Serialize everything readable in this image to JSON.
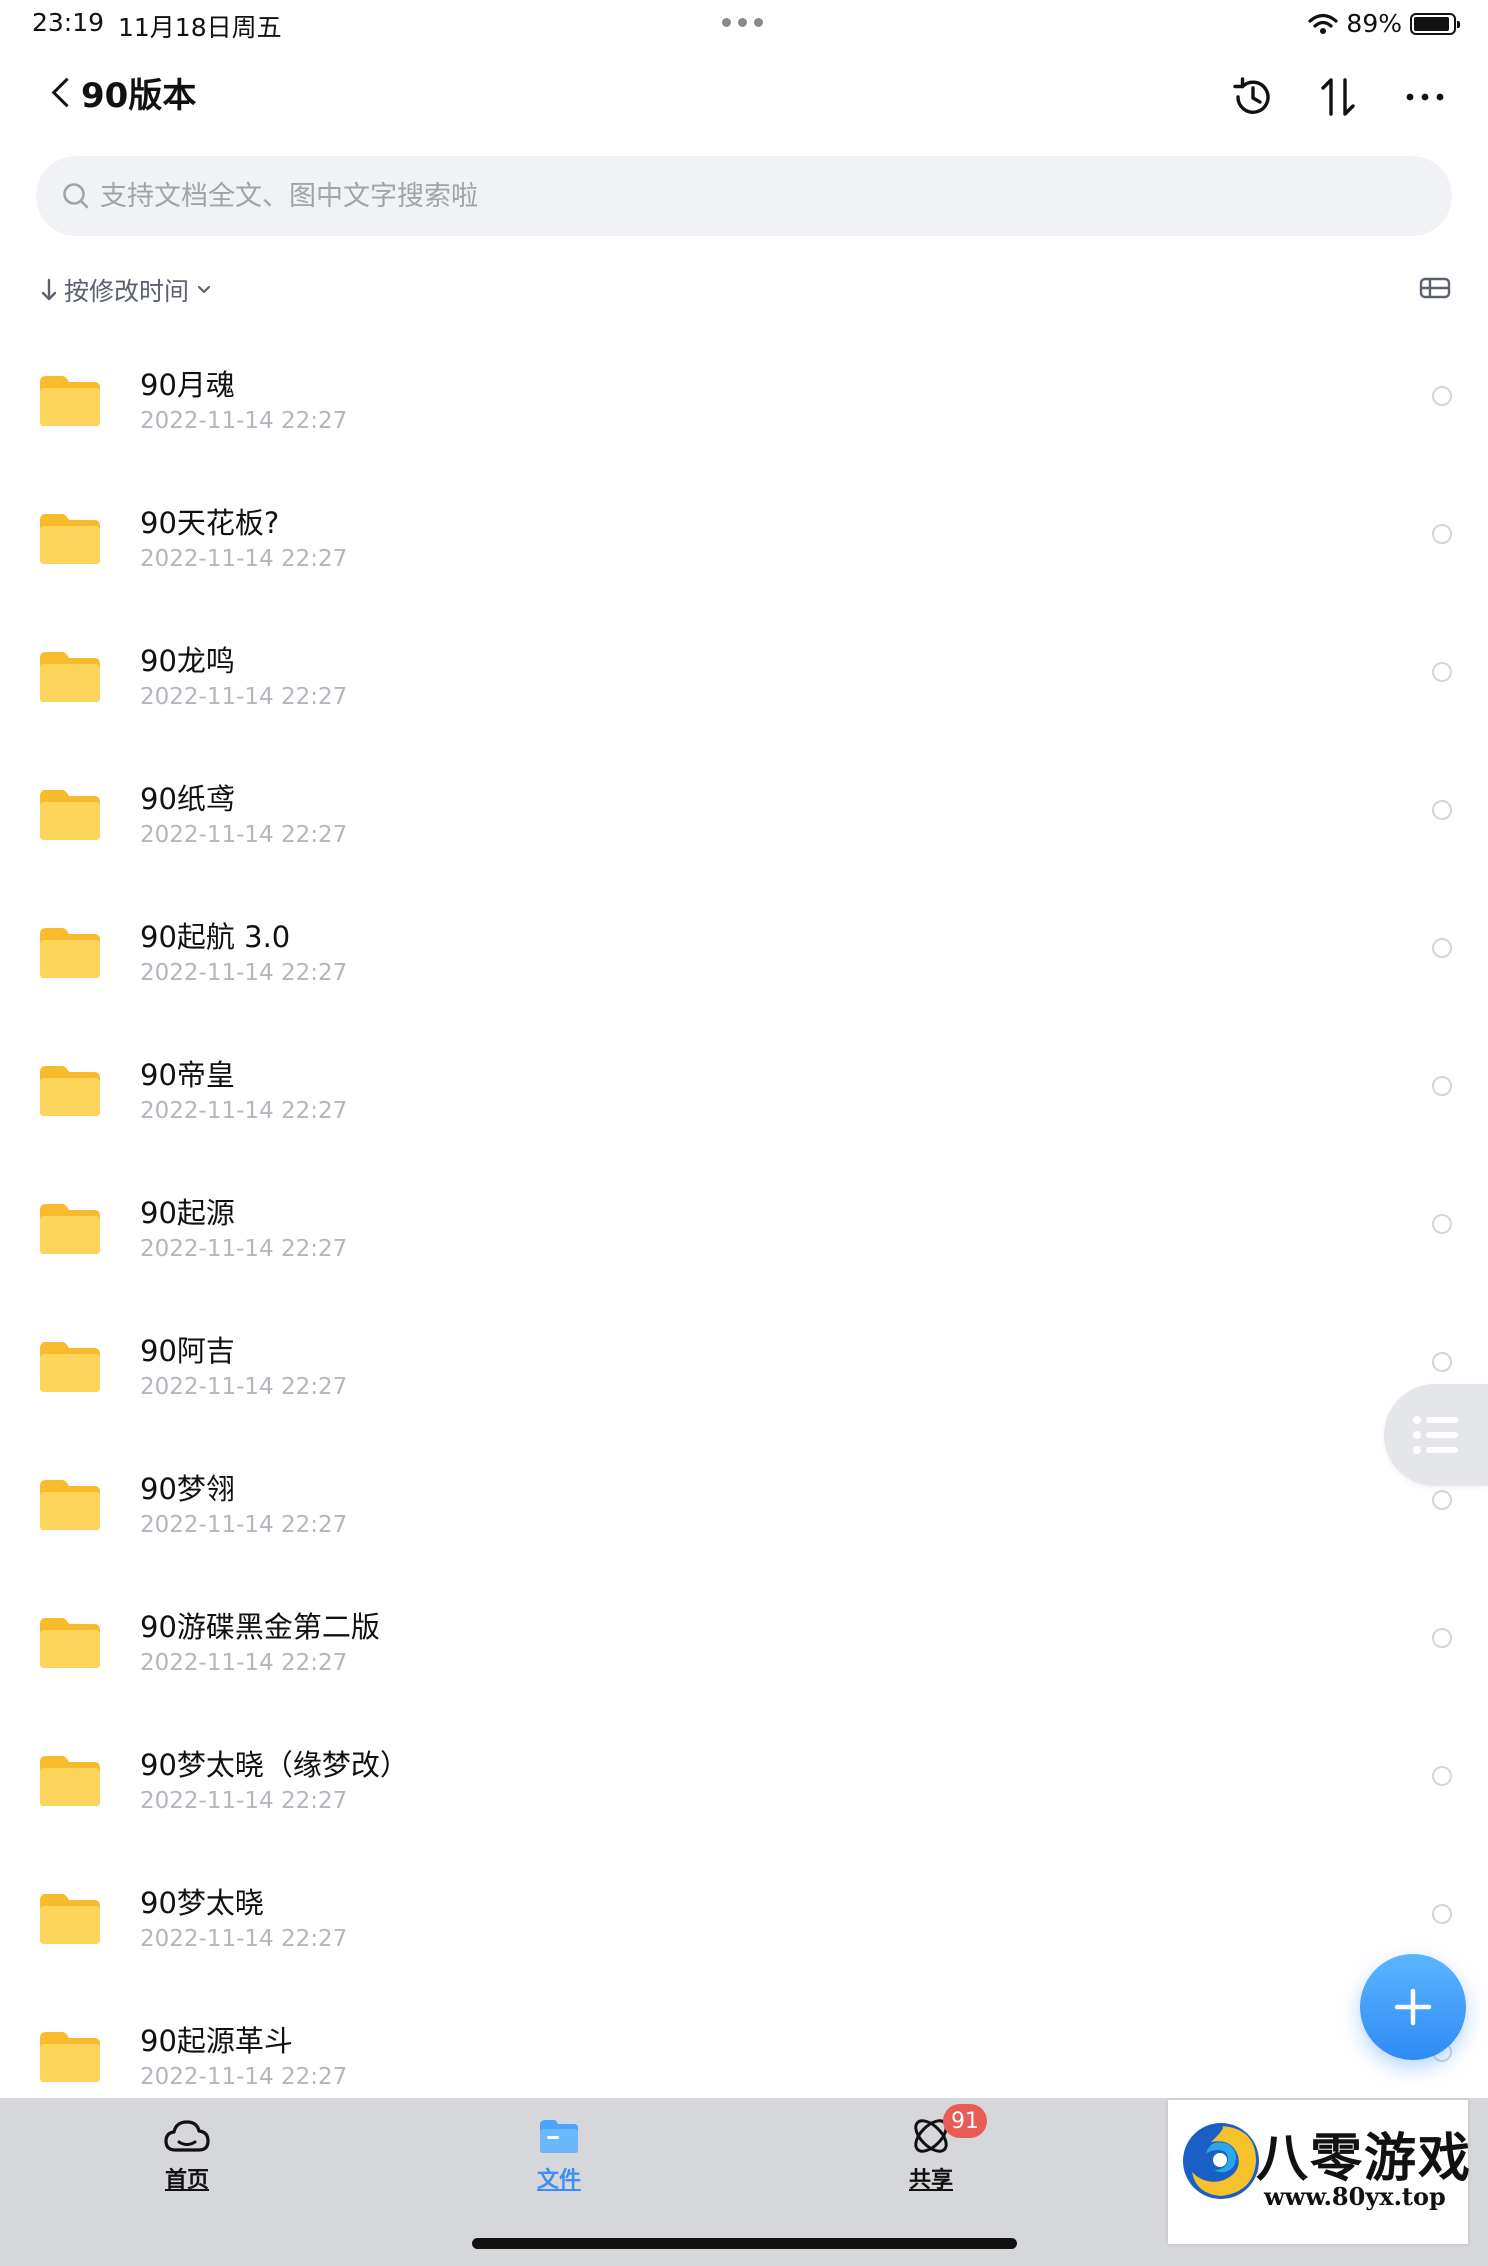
{
  "status_bar": {
    "time": "23:19",
    "date": "11月18日周五",
    "battery_text": "89%",
    "battery_level": 0.89
  },
  "nav": {
    "title": "90版本"
  },
  "search": {
    "placeholder": "支持文档全文、图中文字搜索啦"
  },
  "sort": {
    "label": "按修改时间"
  },
  "files": [
    {
      "name": "90月魂",
      "time": "2022-11-14 22:27"
    },
    {
      "name": "90天花板?",
      "time": "2022-11-14 22:27"
    },
    {
      "name": "90龙鸣",
      "time": "2022-11-14 22:27"
    },
    {
      "name": "90纸鸢",
      "time": "2022-11-14 22:27"
    },
    {
      "name": "90起航 3.0",
      "time": "2022-11-14 22:27"
    },
    {
      "name": "90帝皇",
      "time": "2022-11-14 22:27"
    },
    {
      "name": "90起源",
      "time": "2022-11-14 22:27"
    },
    {
      "name": "90阿吉",
      "time": "2022-11-14 22:27"
    },
    {
      "name": "90梦翎",
      "time": "2022-11-14 22:27"
    },
    {
      "name": "90游碟黑金第二版",
      "time": "2022-11-14 22:27"
    },
    {
      "name": "90梦太晓（缘梦改）",
      "time": "2022-11-14 22:27"
    },
    {
      "name": "90梦太晓",
      "time": "2022-11-14 22:27"
    },
    {
      "name": "90起源革斗",
      "time": "2022-11-14 22:27"
    }
  ],
  "tabs": [
    {
      "label": "首页",
      "icon": "cloud-icon",
      "color": "#111111"
    },
    {
      "label": "文件",
      "icon": "folder-icon",
      "color": "#3d8ef5",
      "active": true
    },
    {
      "label": "共享",
      "icon": "share-icon",
      "color": "#111111",
      "badge": "91"
    }
  ],
  "watermark": {
    "title": "八零游戏",
    "url": "www.80yx.top"
  },
  "colors": {
    "accent": "#3d8ef5",
    "folder": "#fcc93f",
    "badge": "#ea5b56"
  }
}
